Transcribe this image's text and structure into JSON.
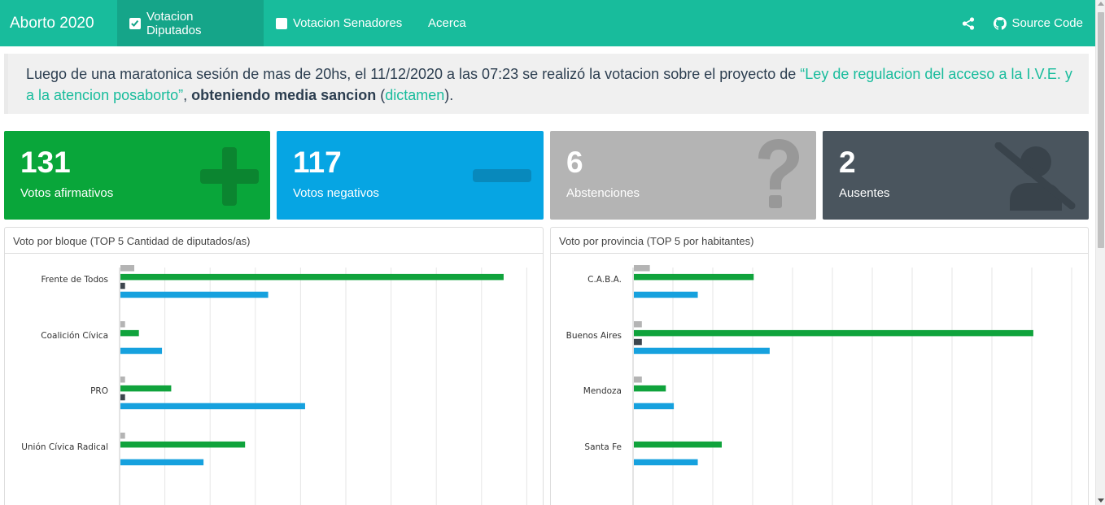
{
  "navbar": {
    "brand": "Aborto 2020",
    "tabs": [
      {
        "label": "Votacion Diputados",
        "checked": true
      },
      {
        "label": "Votacion Senadores",
        "checked": false
      },
      {
        "label": "Acerca"
      }
    ],
    "share_icon": "share-icon",
    "source_label": "Source Code",
    "source_icon": "github-icon"
  },
  "intro": {
    "text1": "Luego de una maratonica sesión de mas de 20hs, el 11/12/2020 a las 07:23 se realizó la votacion sobre el proyecto de ",
    "link": "“Ley de regulacion del acceso a la I.V.E. y a la atencion posaborto”",
    "text2": ", ",
    "bold": "obteniendo media sancion",
    "text3": " (",
    "dictamen": "dictamen",
    "text4": ")."
  },
  "stats": {
    "afirmativos": {
      "value": "131",
      "label": "Votos afirmativos",
      "icon": "plus-icon",
      "color": "#09a63a"
    },
    "negativos": {
      "value": "117",
      "label": "Votos negativos",
      "icon": "minus-icon",
      "color": "#06a5e3"
    },
    "abstenciones": {
      "value": "6",
      "label": "Abstenciones",
      "icon": "question-icon",
      "color": "#b4b4b4"
    },
    "ausentes": {
      "value": "2",
      "label": "Ausentes",
      "icon": "user-slash-icon",
      "color": "#4a555e"
    }
  },
  "colors": {
    "afirmativo": "#10a33c",
    "negativo": "#16a1de",
    "abstencion": "#b4b4b4",
    "ausente": "#3d464e"
  },
  "chart_data": [
    {
      "type": "bar",
      "title": "Voto por bloque (TOP 5 Cantidad de diputados/as)",
      "categories": [
        "Frente de Todos",
        "Coalición Cívica",
        "PRO",
        "Unión Cívica Radical"
      ],
      "series": [
        {
          "key": "abstencion",
          "values": [
            3,
            1,
            1,
            1
          ]
        },
        {
          "key": "afirmativo",
          "values": [
            83,
            4,
            11,
            27
          ]
        },
        {
          "key": "ausente",
          "values": [
            1,
            0,
            1,
            0
          ]
        },
        {
          "key": "negativo",
          "values": [
            32,
            9,
            40,
            18
          ]
        }
      ],
      "xlim": [
        0,
        92
      ]
    },
    {
      "type": "bar",
      "title": "Voto por provincia (TOP 5 por habitantes)",
      "categories": [
        "C.A.B.A.",
        "Buenos Aires",
        "Mendoza",
        "Santa Fe"
      ],
      "series": [
        {
          "key": "abstencion",
          "values": [
            2,
            1,
            1,
            0
          ]
        },
        {
          "key": "afirmativo",
          "values": [
            15,
            50,
            4,
            11
          ]
        },
        {
          "key": "ausente",
          "values": [
            0,
            1,
            0,
            0
          ]
        },
        {
          "key": "negativo",
          "values": [
            8,
            17,
            5,
            8
          ]
        }
      ],
      "xlim": [
        0,
        55
      ]
    }
  ]
}
